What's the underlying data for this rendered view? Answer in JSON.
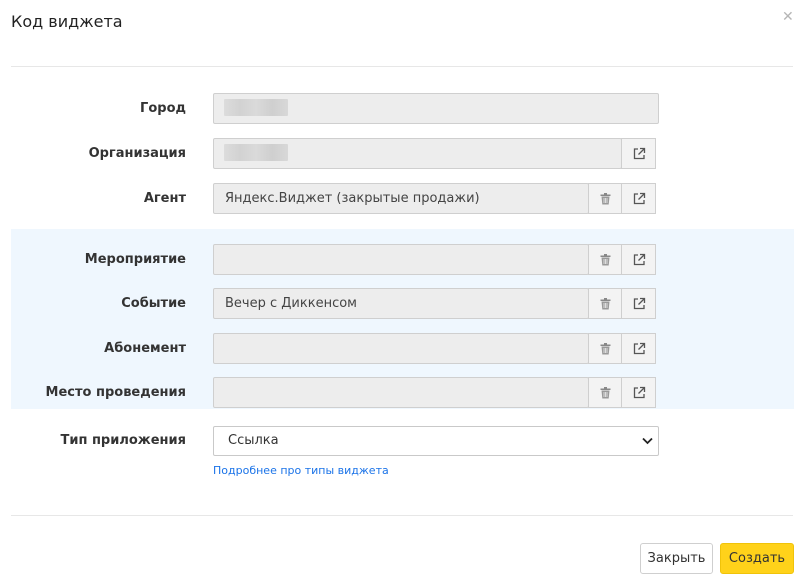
{
  "modal": {
    "title": "Код виджета",
    "close_icon": "close-icon"
  },
  "fields": {
    "city": {
      "label": "Город",
      "value": ""
    },
    "organization": {
      "label": "Организация",
      "value": ""
    },
    "agent": {
      "label": "Агент",
      "value": "Яндекс.Виджет (закрытые продажи)"
    },
    "event": {
      "label": "Мероприятие",
      "value": ""
    },
    "occurrence": {
      "label": "Событие",
      "value": "Вечер с Диккенсом"
    },
    "subscription": {
      "label": "Абонемент",
      "value": ""
    },
    "venue": {
      "label": "Место проведения",
      "value": ""
    }
  },
  "app_type": {
    "label": "Тип приложения",
    "selected": "Ссылка",
    "help_link": "Подробнее про типы виджета"
  },
  "footer": {
    "close_label": "Закрыть",
    "create_label": "Создать"
  },
  "icons": {
    "delete": "trash-icon",
    "open": "external-link-icon",
    "select": "chevron-down-icon"
  },
  "colors": {
    "highlight_band": "#eff7fe",
    "primary_button": "#ffd21a",
    "link": "#1a73e8"
  }
}
